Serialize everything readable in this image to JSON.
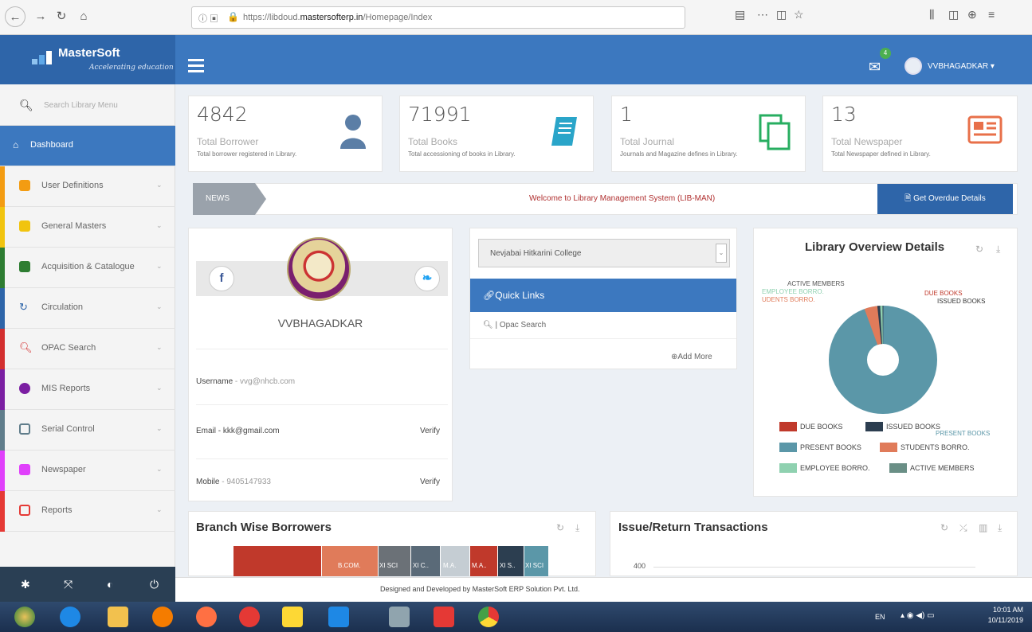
{
  "browser": {
    "url_prefix": "https://libdoud.",
    "url_domain": "mastersofterp.in",
    "url_path": "/Homepage/Index"
  },
  "header": {
    "brand": "MasterSoft",
    "tagline": "Accelerating education",
    "mail_badge": "4",
    "user_name": "VVBHAGADKAR ▾"
  },
  "sidebar": {
    "search_placeholder": "Search Library Menu",
    "items": [
      {
        "label": "Dashboard",
        "color": "#3c78bf"
      },
      {
        "label": "User Definitions",
        "color": "#f39c12"
      },
      {
        "label": "General Masters",
        "color": "#f1c40f"
      },
      {
        "label": "Acquisition & Catalogue",
        "color": "#2e7d32"
      },
      {
        "label": "Circulation",
        "color": "#2e65a9"
      },
      {
        "label": "OPAC Search",
        "color": "#d32f2f"
      },
      {
        "label": "MIS Reports",
        "color": "#7b1fa2"
      },
      {
        "label": "Serial Control",
        "color": "#607d8b"
      },
      {
        "label": "Newspaper",
        "color": "#e040fb"
      },
      {
        "label": "Reports",
        "color": "#e53935"
      }
    ]
  },
  "stats": [
    {
      "value": "4842",
      "title": "Total Borrower",
      "desc": "Total borrower registered in Library.",
      "icon": "user-icon",
      "color": "#5b7ea6"
    },
    {
      "value": "71991",
      "title": "Total Books",
      "desc": "Total accessioning of books in Library.",
      "icon": "book-icon",
      "color": "#2aa5c9"
    },
    {
      "value": "1",
      "title": "Total Journal",
      "desc": "Journals and Magazine defines in Library.",
      "icon": "copy-icon",
      "color": "#27ae60"
    },
    {
      "value": "13",
      "title": "Total Newspaper",
      "desc": "Total Newspaper defined in Library.",
      "icon": "newspaper-icon",
      "color": "#e8704a"
    }
  ],
  "news": {
    "label": "NEWS",
    "text": "Welcome to Library Management System (LIB-MAN)",
    "overdue_button": "Get Overdue Details"
  },
  "profile": {
    "facebook": "f",
    "twitter": "❧",
    "name": "VVBHAGADKAR",
    "username_label": "Username",
    "username_value": " - vvg@nhcb.com",
    "email_label": "Email - kkk@gmail.com",
    "email_verify": "Verify",
    "mobile_label": "Mobile",
    "mobile_value": " - 9405147933",
    "mobile_verify": "Verify"
  },
  "quick_links": {
    "college": "Nevjabai Hitkarini College",
    "title": "Quick Links",
    "item": "Opac Search",
    "add_more": "Add More"
  },
  "overview": {
    "title": "Library Overview Details",
    "callouts": [
      "ACTIVE MEMBERS",
      "EMPLOYEE BORRO.",
      "UDENTS BORRO.",
      "DUE BOOKS",
      "ISSUED BOOKS",
      "PRESENT BOOKS"
    ],
    "legend": [
      {
        "label": "DUE BOOKS",
        "color": "#c0392b"
      },
      {
        "label": "ISSUED BOOKS",
        "color": "#2c3e50"
      },
      {
        "label": "PRESENT BOOKS",
        "color": "#5b97a8"
      },
      {
        "label": "STUDENTS BORRO.",
        "color": "#e07b5a"
      },
      {
        "label": "EMPLOYEE BORRO.",
        "color": "#8fd1b0"
      },
      {
        "label": "ACTIVE MEMBERS",
        "color": "#6a8f86"
      }
    ]
  },
  "branch": {
    "title": "Branch Wise Borrowers",
    "bars": [
      {
        "label": "",
        "color": "#c0392b"
      },
      {
        "label": "B.COM.",
        "color": "#e07b5a"
      },
      {
        "label": "XI SCI",
        "color": "#6b7177"
      },
      {
        "label": "XI C..",
        "color": "#5a6a78"
      },
      {
        "label": "M.A.",
        "color": "#c5cdd3"
      },
      {
        "label": "M.A..",
        "color": "#c0392b"
      },
      {
        "label": "XI S..",
        "color": "#2c3e50"
      },
      {
        "label": "XI SCI",
        "color": "#5b97a8"
      }
    ]
  },
  "issue": {
    "title": "Issue/Return Transactions",
    "axis_tick": "400"
  },
  "footer": {
    "text": "Designed and Developed by MasterSoft ERP Solution Pvt. Ltd."
  },
  "taskbar": {
    "lang": "EN",
    "time": "10:01 AM",
    "date": "10/11/2019"
  }
}
